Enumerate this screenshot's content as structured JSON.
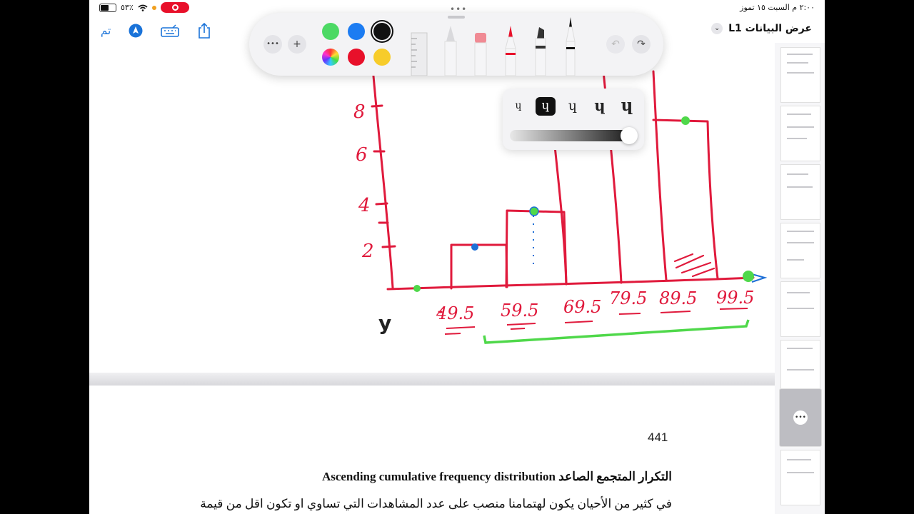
{
  "status_bar": {
    "time": "٢:٠٠ م   السبت ١٥ تموز",
    "battery": "٥٣٪"
  },
  "toolbar": {
    "done_label": "تم",
    "doc_title": "عرض البيانات L1",
    "chevron": "⌄"
  },
  "markup_palette": {
    "more_label": "•••",
    "add_label": "+",
    "colors": [
      "#4cd964",
      "#1c7cf2",
      "#111111",
      "#e8102a",
      "#f7cc2a"
    ],
    "selected_color": "#111111",
    "tools": [
      "ruler",
      "pencil",
      "eraser",
      "marker",
      "highlighter",
      "pen"
    ],
    "undo_icon": "undo-icon",
    "redo_icon": "redo-icon"
  },
  "stroke_styles": {
    "glyph": "ɥ",
    "options": 5,
    "selected": 2,
    "opacity": 0.95
  },
  "handwritten_chart": {
    "y_ticks": [
      "8",
      "6",
      "4",
      "2"
    ],
    "x_ticks": [
      "49.5",
      "59.5",
      "69.5",
      "79.5",
      "89.5",
      "99.5"
    ],
    "y_axis_letter": "y",
    "bar_heights": [
      2,
      3,
      null,
      null,
      7
    ],
    "colors": {
      "ink": "#e01a3c",
      "green": "#4fd84a",
      "blue": "#1d6fd6"
    }
  },
  "document": {
    "page_number": "441",
    "heading": "التكرار المتجمع الصاعد Ascending cumulative frequency distribution",
    "paragraph": "في كثير من  الأحيان يكون لهتمامنا منصب على عدد المشاهدات التي تساوي او تكون اقل من قيمة"
  }
}
